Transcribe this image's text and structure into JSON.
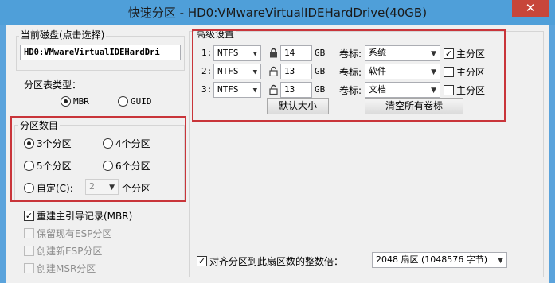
{
  "window": {
    "title": "快速分区 - HD0:VMwareVirtualIDEHardDrive(40GB)",
    "close_glyph": "✕"
  },
  "current_disk": {
    "label": "当前磁盘(点击选择)",
    "value": "HD0:VMwareVirtualIDEHardDri"
  },
  "partition_table": {
    "label": "分区表类型：",
    "options": [
      "MBR",
      "GUID"
    ],
    "selected": "MBR"
  },
  "partition_count": {
    "label": "分区数目",
    "options": [
      "3个分区",
      "4个分区",
      "5个分区",
      "6个分区"
    ],
    "custom_label": "自定(C):",
    "custom_value": "2",
    "custom_suffix": "个分区",
    "selected": "3个分区"
  },
  "checks": [
    {
      "label": "重建主引导记录(MBR)",
      "checked": true
    },
    {
      "label": "保留现有ESP分区",
      "checked": false
    },
    {
      "label": "创建新ESP分区",
      "checked": false
    },
    {
      "label": "创建MSR分区",
      "checked": false
    }
  ],
  "advanced": {
    "label": "高级设置",
    "rows": [
      {
        "index": "1:",
        "fs": "NTFS",
        "size": "14",
        "unit": "GB",
        "vol_label": "卷标:",
        "volume": "系统",
        "primary_label": "主分区",
        "primary": true
      },
      {
        "index": "2:",
        "fs": "NTFS",
        "size": "13",
        "unit": "GB",
        "vol_label": "卷标:",
        "volume": "软件",
        "primary_label": "主分区",
        "primary": false
      },
      {
        "index": "3:",
        "fs": "NTFS",
        "size": "13",
        "unit": "GB",
        "vol_label": "卷标:",
        "volume": "文档",
        "primary_label": "主分区",
        "primary": false
      }
    ],
    "default_size_button": "默认大小",
    "clear_labels_button": "清空所有卷标"
  },
  "align": {
    "label": "对齐分区到此扇区数的整数倍：",
    "checked": true,
    "value": "2048 扇区 (1048576 字节)"
  },
  "colors": {
    "title_bar": "#4f9fd9",
    "close_button": "#c7463a",
    "highlight_border": "#c9353a",
    "dialog_bg": "#f0f0f0"
  }
}
